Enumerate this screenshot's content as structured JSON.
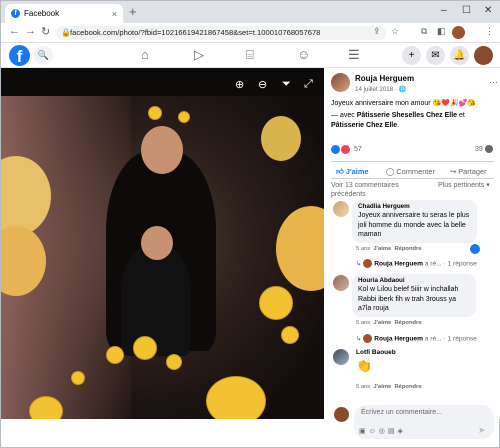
{
  "browser": {
    "tab_title": "Facebook",
    "tab_close": "×",
    "new_tab": "+",
    "url": "facebook.com/photo/?fbid=10216619421867458&set=t.100010768057678",
    "window_controls": [
      "–",
      "☐",
      "✕"
    ]
  },
  "facebook": {
    "logo_letter": "f",
    "nav_icons": [
      "home-icon",
      "watch-icon",
      "marketplace-icon",
      "groups-icon",
      "menu-icon"
    ],
    "right_icons": [
      "create-icon",
      "messenger-icon",
      "notifications-icon",
      "account-icon"
    ]
  },
  "post": {
    "author": "Rouja Herguem",
    "date": "14 juillet 2018 · ",
    "caption": "Joyeux anniversaire mon amour 😘❤️🎉💕😘",
    "with_prefix": "— avec ",
    "with_page1": "Pâtisserie Sheselles Chez Elle",
    "with_and": " et ",
    "with_page2": "Pâtisserie Chez Elle",
    "with_end": ".",
    "reaction_count": "57",
    "comment_count": "39",
    "like_label": "J'aime",
    "comment_label": "Commenter",
    "share_label": "Partager",
    "view_previous": "Voir 13 commentaires précédents",
    "sort_label": "Plus pertinents ▾"
  },
  "comments": [
    {
      "author": "Chadlia Herguem",
      "text": "Joyeux anniversaire tu seras le plus joli homme du monde avec la belle maman",
      "time": "5 ans",
      "like": "J'aime",
      "reply": "Répondre",
      "replier": "Rouja Herguem",
      "replied": "a ré...",
      "reply_count": "· 1 réponse"
    },
    {
      "author": "Houria Abdaoui",
      "text": "Kol w Lilou belef 5iiir w inchallah Rabbi iberk fih w trah 3rouss ya a7la rouja",
      "time": "5 ans",
      "like": "J'aime",
      "reply": "Répondre",
      "replier": "Rouja Herguem",
      "replied": "a ré...",
      "reply_count": "· 1 réponse"
    },
    {
      "author": "Lotfi Baoueb",
      "text": "👏",
      "time": "5 ans",
      "like": "J'aime",
      "reply": "Répondre"
    }
  ],
  "composer": {
    "placeholder": "Écrivez un commentaire...",
    "icons": [
      "sticker-icon",
      "emoji-icon",
      "camera-icon",
      "gif-icon",
      "sticker2-icon"
    ]
  },
  "colors": {
    "facebook_blue": "#1877f2",
    "love_red": "#f33e58",
    "emoji_yellow": "#f2c230"
  }
}
